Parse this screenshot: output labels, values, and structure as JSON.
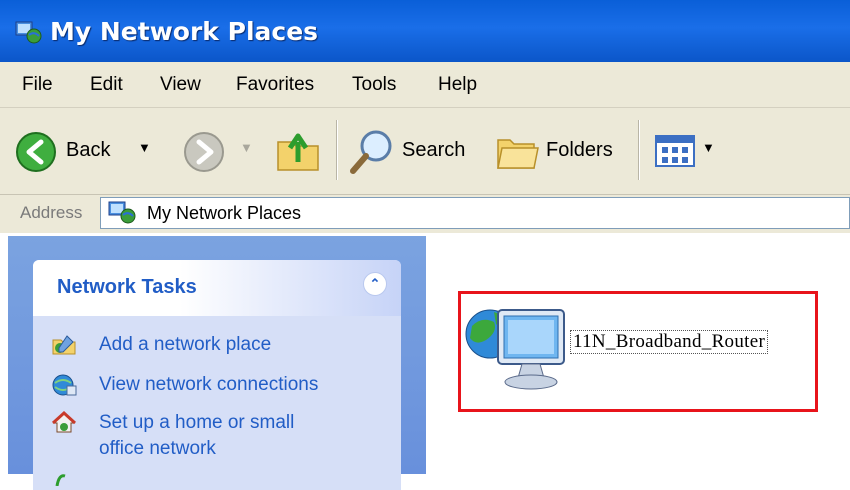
{
  "window": {
    "title": "My Network Places"
  },
  "menu": {
    "items": [
      "File",
      "Edit",
      "View",
      "Favorites",
      "Tools",
      "Help"
    ]
  },
  "toolbar": {
    "back_label": "Back",
    "search_label": "Search",
    "folders_label": "Folders"
  },
  "address": {
    "label": "Address",
    "value": "My Network Places"
  },
  "tasks": {
    "title": "Network Tasks",
    "items": [
      {
        "label": "Add a network place",
        "icon": "add-network-place-icon"
      },
      {
        "label": "View network connections",
        "icon": "network-connections-icon"
      },
      {
        "label": "Set up a home or small office network",
        "line1": "Set up a home or small",
        "line2": "office network",
        "icon": "home-network-icon"
      }
    ]
  },
  "content": {
    "items": [
      {
        "label": "11N_Broadband_Router",
        "icon": "network-computer-icon"
      }
    ]
  },
  "colors": {
    "titlebar": "#0a5fd8",
    "highlight": "#e8141b",
    "task_link": "#215dc6"
  }
}
